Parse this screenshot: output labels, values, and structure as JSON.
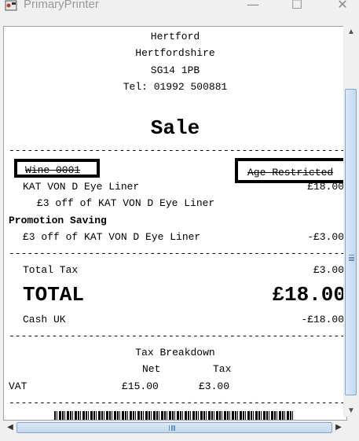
{
  "window": {
    "title": "PrimaryPrinter",
    "controls": {
      "minimize": "—",
      "maximize": "☐",
      "close": "✕"
    }
  },
  "receipt": {
    "address": [
      "Hertford",
      "Hertfordshire",
      "SG14 1PB",
      "Tel: 01992 500881"
    ],
    "heading": "Sale",
    "divider": "------------------------------------------------------------",
    "tag_left": "Wine 0001",
    "tag_right": "Age Restricted",
    "item": {
      "name": "KAT VON D Eye Liner",
      "price": "£18.00"
    },
    "item_offer": "£3 off of KAT VON D Eye Liner",
    "promotion_title": "Promotion Saving",
    "promotion": {
      "name": "£3 off of KAT VON D Eye Liner",
      "amount": "-£3.00"
    },
    "total_tax": {
      "label": "Total Tax",
      "amount": "£3.00"
    },
    "total": {
      "label": "TOTAL",
      "amount": "£18.00"
    },
    "payment": {
      "label": "Cash UK",
      "amount": "-£18.00"
    },
    "tax_breakdown": {
      "title": "Tax Breakdown",
      "col_net": "Net",
      "col_tax": "Tax",
      "row_label": "VAT",
      "row_net": "£15.00",
      "row_tax": "£3.00"
    }
  },
  "scrollbars": {
    "up_arrow": "▲",
    "down_arrow": "▼",
    "left_arrow": "◀",
    "right_arrow": "▶"
  }
}
